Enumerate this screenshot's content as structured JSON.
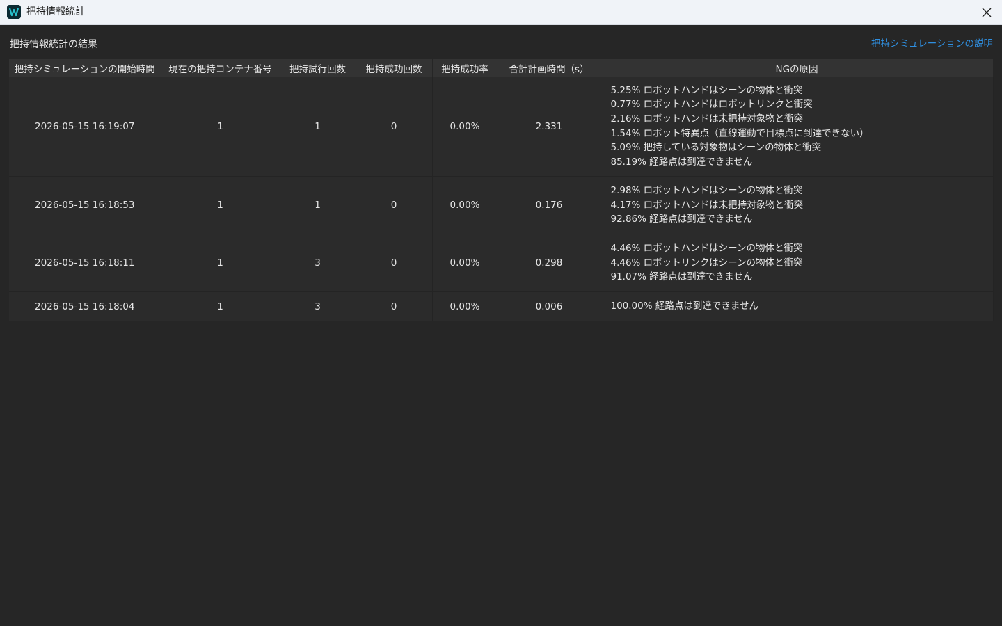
{
  "window": {
    "title": "把持情報統計",
    "icon": "app-logo-icon",
    "close_icon": "close-icon"
  },
  "header": {
    "result_title": "把持情報統計の結果",
    "help_link": "把持シミュレーションの説明"
  },
  "table": {
    "columns": [
      "把持シミュレーションの開始時間",
      "現在の把持コンテナ番号",
      "把持試行回数",
      "把持成功回数",
      "把持成功率",
      "合計計画時間（s）",
      "NGの原因"
    ],
    "rows": [
      {
        "start_time": "2026-05-15 16:19:07",
        "container_no": "1",
        "attempts": "1",
        "successes": "0",
        "success_rate": "0.00%",
        "plan_time": "2.331",
        "ng": [
          "5.25% ロボットハンドはシーンの物体と衝突",
          "0.77% ロボットハンドはロボットリンクと衝突",
          "2.16% ロボットハンドは未把持対象物と衝突",
          "1.54% ロボット特異点（直線運動で目標点に到達できない）",
          "5.09% 把持している対象物はシーンの物体と衝突",
          "85.19% 経路点は到達できません"
        ]
      },
      {
        "start_time": "2026-05-15 16:18:53",
        "container_no": "1",
        "attempts": "1",
        "successes": "0",
        "success_rate": "0.00%",
        "plan_time": "0.176",
        "ng": [
          "2.98% ロボットハンドはシーンの物体と衝突",
          "4.17% ロボットハンドは未把持対象物と衝突",
          "92.86% 経路点は到達できません"
        ]
      },
      {
        "start_time": "2026-05-15 16:18:11",
        "container_no": "1",
        "attempts": "3",
        "successes": "0",
        "success_rate": "0.00%",
        "plan_time": "0.298",
        "ng": [
          "4.46% ロボットハンドはシーンの物体と衝突",
          "4.46% ロボットリンクはシーンの物体と衝突",
          "91.07% 経路点は到達できません"
        ]
      },
      {
        "start_time": "2026-05-15 16:18:04",
        "container_no": "1",
        "attempts": "3",
        "successes": "0",
        "success_rate": "0.00%",
        "plan_time": "0.006",
        "ng": [
          "100.00% 経路点は到達できません"
        ]
      }
    ]
  },
  "colors": {
    "background": "#262626",
    "header_bg": "#333333",
    "row_bg": "#2b2b2b",
    "link": "#2f8fe0",
    "titlebar": "#f0f3f8"
  }
}
